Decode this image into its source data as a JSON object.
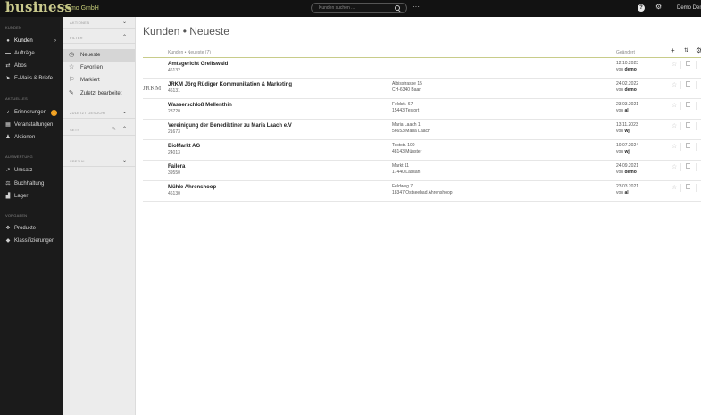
{
  "topbar": {
    "logo": "business",
    "company": "Demo GmbH",
    "search_placeholder": "Kunden suchen ...",
    "more": "···",
    "help": "?",
    "user": "Demo Demo"
  },
  "nav": {
    "sections": {
      "kunden": "KUNDEN",
      "aktuelles": "AKTUELLES",
      "auswertung": "AUSWERTUNG",
      "vorgaben": "VORGABEN"
    },
    "items": [
      {
        "label": "Kunden",
        "icon": "user-icon",
        "chevron": "›"
      },
      {
        "label": "Aufträge",
        "icon": "orders-icon"
      },
      {
        "label": "Abos",
        "icon": "repeat-icon"
      },
      {
        "label": "E-Mails & Briefe",
        "icon": "send-icon"
      },
      {
        "label": "Erinnerungen",
        "icon": "bell-icon",
        "badge": "1"
      },
      {
        "label": "Veranstaltungen",
        "icon": "calendar-icon"
      },
      {
        "label": "Aktionen",
        "icon": "people-icon"
      },
      {
        "label": "Umsatz",
        "icon": "chart-icon"
      },
      {
        "label": "Buchhaltung",
        "icon": "accounting-icon"
      },
      {
        "label": "Lager",
        "icon": "warehouse-icon"
      },
      {
        "label": "Produkte",
        "icon": "products-icon"
      },
      {
        "label": "Klassifizierungen",
        "icon": "tag-icon"
      }
    ]
  },
  "filter": {
    "aktionen": "AKTIONEN",
    "filter": "FILTER",
    "items": [
      {
        "label": "Neueste",
        "icon": "clock-icon"
      },
      {
        "label": "Favoriten",
        "icon": "star-icon"
      },
      {
        "label": "Markiert",
        "icon": "flag-icon"
      },
      {
        "label": "Zuletzt bearbeitet",
        "icon": "pencil-icon"
      }
    ],
    "zuletzt_gesucht": "ZULETZT GESUCHT",
    "sets": "SETS",
    "spezial": "SPEZIAL"
  },
  "main": {
    "title": "Kunden • Neueste",
    "list_header": "Kunden • Neueste (7)",
    "col_changed": "Geändert",
    "rows": [
      {
        "name": "Amtsgericht Greifswald",
        "num": "46132",
        "addr1": "",
        "addr2": "",
        "date": "12.10.2023",
        "by_prefix": "von",
        "by": "demo",
        "logo": ""
      },
      {
        "name": "JRKM Jörg Rüdiger Kommunikation & Marketing",
        "num": "46131",
        "addr1": "Albisstrasse 15",
        "addr2": "CH-6340 Baar",
        "date": "24.02.2022",
        "by_prefix": "von",
        "by": "demo",
        "logo": "JRKM"
      },
      {
        "name": "Wasserschloß Mellenthin",
        "num": "28720",
        "addr1": "Feldstr. 67",
        "addr2": "15443 Testort",
        "date": "23.03.2021",
        "by_prefix": "von",
        "by": "al",
        "logo": ""
      },
      {
        "name": "Vereinigung der Benediktiner zu Maria Laach e.V",
        "num": "21673",
        "addr1": "Maria Laach 1",
        "addr2": "56653 Maria Laach",
        "date": "13.11.2023",
        "by_prefix": "von",
        "by": "wj",
        "logo": ""
      },
      {
        "name": "BioMarkt AG",
        "num": "24013",
        "addr1": "Teststr. 100",
        "addr2": "48143 Münster",
        "date": "10.07.2024",
        "by_prefix": "von",
        "by": "wj",
        "logo": ""
      },
      {
        "name": "Failera",
        "num": "39550",
        "addr1": "Markt 11",
        "addr2": "17440 Lassan",
        "date": "24.09.2021",
        "by_prefix": "von",
        "by": "demo",
        "logo": ""
      },
      {
        "name": "Mühle Ahrenshoop",
        "num": "46130",
        "addr1": "Feldweg 7",
        "addr2": "18347 Ostseebad Ahrenshoop",
        "date": "23.03.2021",
        "by_prefix": "von",
        "by": "al",
        "logo": ""
      }
    ]
  }
}
